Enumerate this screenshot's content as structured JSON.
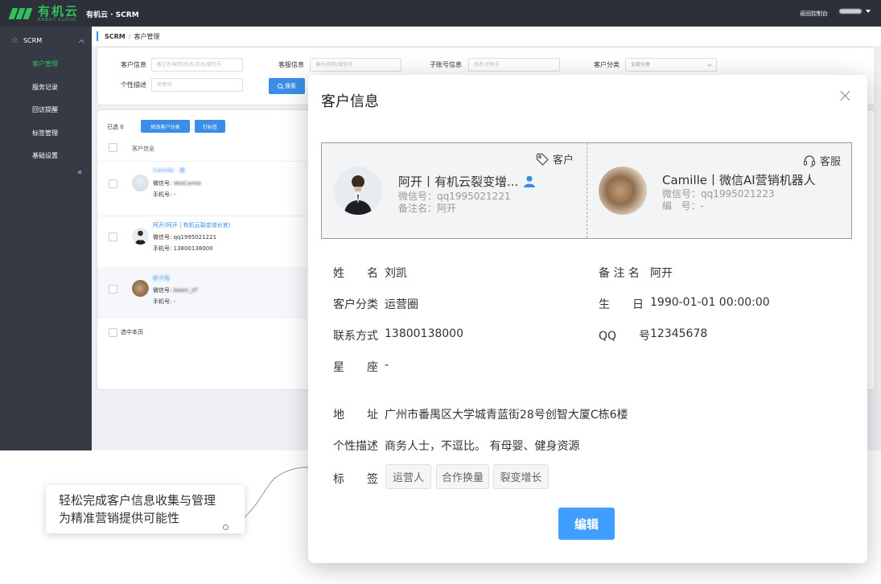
{
  "topbar": {
    "logo_cn": "有机云",
    "logo_en": "ROBOT CLOUD",
    "app_title": "有机云 · SCRM",
    "back_console": "返回控制台",
    "user_name": "camille"
  },
  "sidebar": {
    "section": "SCRM",
    "items": [
      {
        "label": "客户管理",
        "active": true
      },
      {
        "label": "服务记录"
      },
      {
        "label": "回访提醒"
      },
      {
        "label": "标签管理"
      },
      {
        "label": "基础设置"
      }
    ],
    "collapse_icon": "double-chevron-left-icon"
  },
  "breadcrumb": {
    "root": "SCRM",
    "sep": "/",
    "current": "客户管理"
  },
  "filters": {
    "customer_info": {
      "label": "客户信息",
      "placeholder": "备注名/昵称/姓名/手机/微信号"
    },
    "service_info": {
      "label": "客服信息",
      "placeholder": "编号/昵称/微信号"
    },
    "sub_account": {
      "label": "子账号信息",
      "placeholder": "姓名/子账号"
    },
    "category": {
      "label": "客户分类",
      "value": "全部分类"
    },
    "profile_desc": {
      "label": "个性描述",
      "placeholder": "关键词"
    },
    "search_button": "搜索"
  },
  "list": {
    "selected": "已选 0",
    "btn_modify_category": "修改客户分类",
    "btn_tag": "打标签",
    "column_header": "客户信息",
    "rows": [
      {
        "name": "Camille · 微",
        "wechat_label": "微信号:",
        "wechat": "VesCamie",
        "phone_label": "手机号:",
        "phone": "-"
      },
      {
        "name": "阿开(阿开丨有机云裂变增长官)",
        "wechat_label": "微信号:",
        "wechat": "qq1995021221",
        "phone_label": "手机号:",
        "phone": "13800138000"
      },
      {
        "name": "新子恒",
        "wechat_label": "微信号:",
        "wechat": "bisen_zT",
        "phone_label": "手机号:",
        "phone": "-"
      }
    ],
    "select_page": "选中本页"
  },
  "modal": {
    "title": "客户信息",
    "customer_card": {
      "tag": "客户",
      "name": "阿开丨有机云裂变增...",
      "wechat": "微信号：qq1995021221",
      "remark": "备注名：阿开"
    },
    "service_card": {
      "tag": "客服",
      "name": "Camille丨微信AI营销机器人",
      "wechat": "微信号：qq1995021223",
      "number": "编   号：-"
    },
    "fields": {
      "name_label": "姓　　名",
      "name": "刘凯",
      "remark_label": "备 注 名",
      "remark": "阿开",
      "category_label": "客户分类",
      "category": "运营圈",
      "birthday_label": "生　　日",
      "birthday": "1990-01-01 00:00:00",
      "contact_label": "联系方式",
      "contact": "13800138000",
      "qq_label": "QQ　　号",
      "qq": "12345678",
      "zodiac_label": "星　　座",
      "zodiac": "-",
      "address_label": "地　　址",
      "address": "广州市番禺区大学城青蓝街28号创智大厦C栋6楼",
      "desc_label": "个性描述",
      "desc": "商务人士，不逗比。 有母婴、健身资源",
      "tags_label": "标　　签"
    },
    "tags": [
      "运营人",
      "合作换量",
      "裂变增长"
    ],
    "edit_button": "编辑"
  },
  "callout": {
    "line1": "轻松完成客户信息收集与管理",
    "line2": "为精准营销提供可能性"
  },
  "colors": {
    "topbar": "#2d3039",
    "sidebar": "#363a45",
    "brand_green": "#2fbf5d",
    "primary_blue": "#3a8ee6",
    "edit_blue": "#409eff"
  }
}
